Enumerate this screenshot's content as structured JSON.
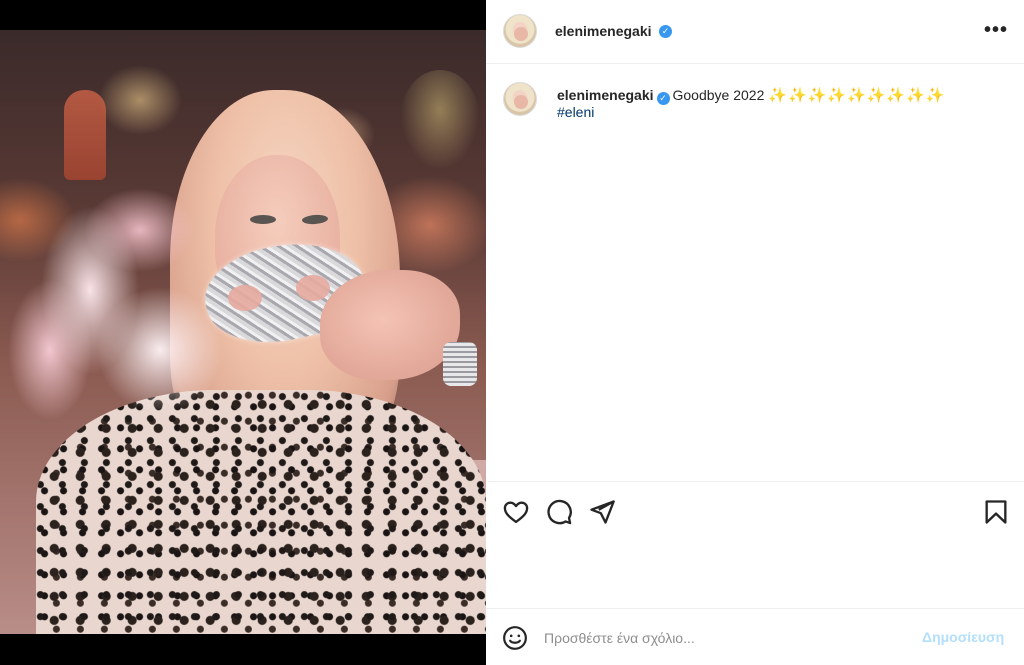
{
  "post": {
    "username": "elenimenegaki",
    "verified_icon": "verified-badge-icon",
    "more_icon": "more-options-icon",
    "more_label": "•••"
  },
  "caption": {
    "username": "elenimenegaki",
    "text": "Goodbye 2022",
    "emojis": "✨✨✨✨✨✨✨✨✨",
    "hashtag": "#eleni"
  },
  "actions": {
    "like_icon": "heart-icon",
    "comment_icon": "comment-icon",
    "share_icon": "share-icon",
    "save_icon": "bookmark-icon"
  },
  "comment_box": {
    "emoji_icon": "smiley-icon",
    "placeholder": "Προσθέστε ένα σχόλιο...",
    "post_label": "Δημοσίευση"
  },
  "colors": {
    "verified": "#3897f0",
    "hashtag": "#00376b",
    "post_button_disabled": "#b2dffc",
    "border": "#efefef"
  }
}
